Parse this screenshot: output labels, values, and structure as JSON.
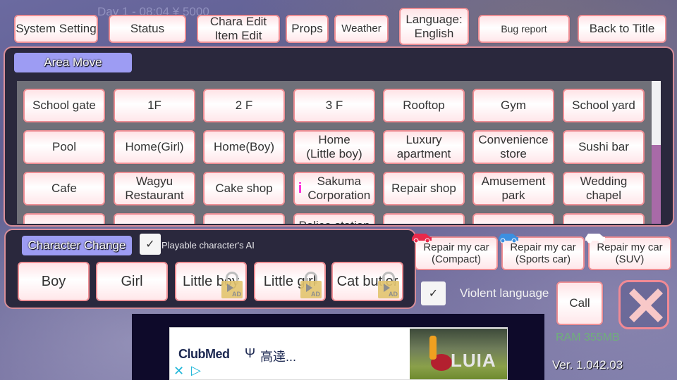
{
  "status_bar": {
    "text": "Day 1 - 08:04  ¥ 5000"
  },
  "top_menu": [
    {
      "id": "system-setting",
      "label": "System Setting"
    },
    {
      "id": "status",
      "label": "Status"
    },
    {
      "id": "chara-edit",
      "label": "Chara Edit\nItem Edit"
    },
    {
      "id": "props",
      "label": "Props"
    },
    {
      "id": "weather",
      "label": "Weather"
    },
    {
      "id": "language",
      "label": "Language:\nEnglish"
    },
    {
      "id": "bug-report",
      "label": "Bug report"
    },
    {
      "id": "back-to-title",
      "label": "Back to Title"
    }
  ],
  "area_move": {
    "title": "Area Move",
    "locations": [
      "School gate",
      "1F",
      "2 F",
      "3 F",
      "Rooftop",
      "Gym",
      "School yard",
      "Pool",
      "Home(Girl)",
      "Home(Boy)",
      "Home\n(Little boy)",
      "Luxury\napartment",
      "Convenience\nstore",
      "Sushi bar",
      "Cafe",
      "Wagyu\nRestaurant",
      "Cake shop",
      "Sakuma\nCorporation",
      "Repair shop",
      "Amusement\npark",
      "Wedding\nchapel",
      "",
      "",
      "",
      "Police station",
      "",
      "",
      ""
    ],
    "info_marker": "i",
    "scroll_position": 0.55
  },
  "character_change": {
    "title": "Character Change",
    "ai_checkbox_label": "Playable character's AI",
    "ai_checked": true,
    "check_glyph": "✓",
    "characters": [
      {
        "label": "Boy",
        "locked": false
      },
      {
        "label": "Girl",
        "locked": false
      },
      {
        "label": "Little boy",
        "locked": true
      },
      {
        "label": "Little girl",
        "locked": true
      },
      {
        "label": "Cat butler",
        "locked": true
      }
    ],
    "lock_badge": "AD"
  },
  "repair": [
    {
      "label": "Repair my car\n(Compact)",
      "color": "#e8294a"
    },
    {
      "label": "Repair my car\n(Sports car)",
      "color": "#3b8fe0"
    },
    {
      "label": "Repair my car\n(SUV)",
      "color": "#ffffff"
    }
  ],
  "violent_language": {
    "label": "Violent language",
    "checked": true
  },
  "call_button": "Call",
  "ram": "RAM 355MB",
  "version": "Ver. 1.042.03",
  "ad": {
    "brand": "ClubMed",
    "text": "高達...",
    "close": "✕",
    "adchoices": "▷",
    "image_text": "LUIA"
  }
}
